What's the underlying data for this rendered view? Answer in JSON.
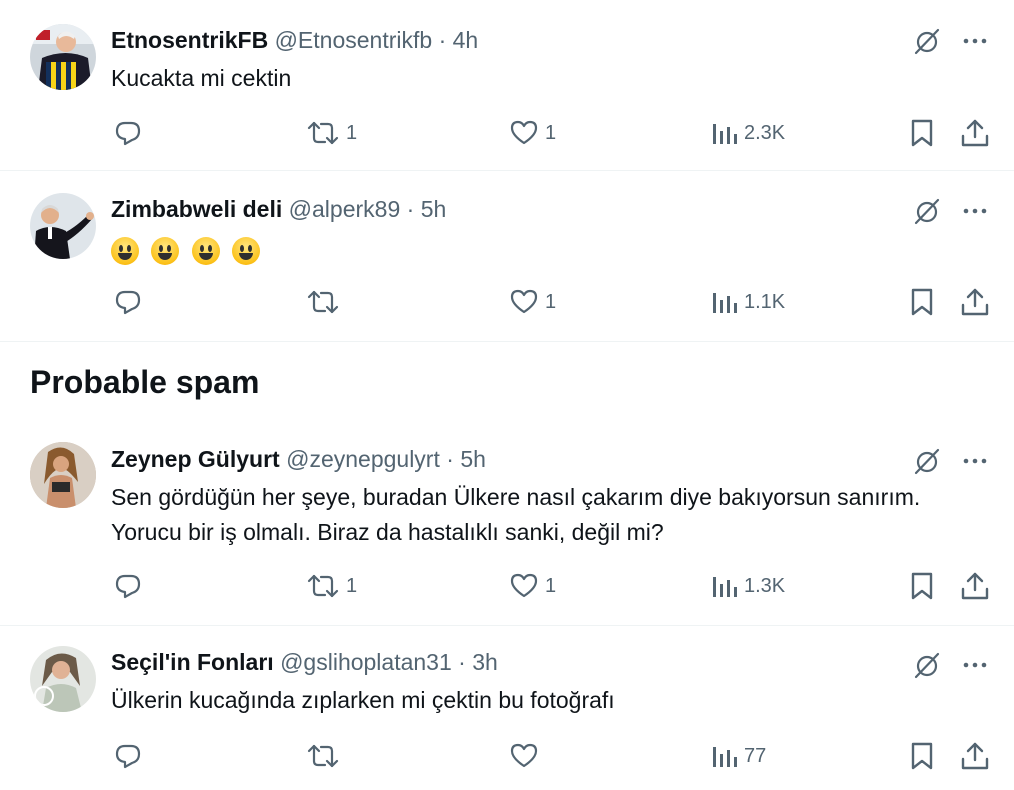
{
  "tweets": [
    {
      "display_name": "EtnosentrikFB",
      "handle": "@Etnosentrikfb",
      "separator": "·",
      "time": "4h",
      "text": "Kucakta mi cektin",
      "retweets": "1",
      "likes": "1",
      "views": "2.3K"
    },
    {
      "display_name": "Zimbabweli deli",
      "handle": "@alperk89",
      "separator": "·",
      "time": "5h",
      "text": "",
      "emoji": [
        "grinning-face",
        "grinning-face",
        "grinning-face",
        "grinning-face"
      ],
      "retweets": "",
      "likes": "1",
      "views": "1.1K"
    },
    {
      "display_name": "Zeynep Gülyurt",
      "handle": "@zeynepgulyrt",
      "separator": "·",
      "time": "5h",
      "text": "Sen gördüğün her şeye, buradan Ülkere nasıl çakarım diye bakıyorsun sanırım. Yorucu bir iş olmalı. Biraz da hastalıklı sanki, değil mi?",
      "retweets": "1",
      "likes": "1",
      "views": "1.3K"
    },
    {
      "display_name": "Seçil'in Fonları",
      "handle": "@gslihoplatan31",
      "separator": "·",
      "time": "3h",
      "text": "Ülkerin kucağında zıplarken mi çektin bu fotoğrafı",
      "retweets": "",
      "likes": "",
      "views": "77"
    }
  ],
  "section_title": "Probable spam",
  "colors": {
    "text_primary": "#0f1419",
    "text_secondary": "#536471",
    "divider": "#eff3f4"
  },
  "icons": [
    "reply-icon",
    "retweet-icon",
    "like-icon",
    "views-icon",
    "bookmark-icon",
    "share-icon",
    "grok-icon",
    "more-icon"
  ]
}
